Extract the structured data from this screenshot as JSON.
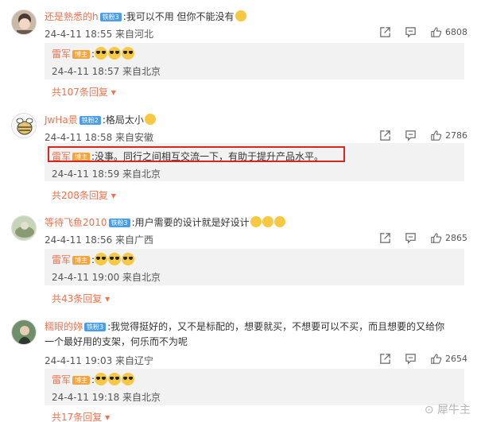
{
  "icons": {
    "share": "share-icon",
    "comment": "comment-icon",
    "like": "thumbs-up-icon",
    "host_badge": "host-badge",
    "level_badge": "level-badge"
  },
  "colors": {
    "username": "#eb7350",
    "reply_bg": "#f2f2f2",
    "highlight": "#d7261c",
    "badge": "#4a9ee9"
  },
  "comments": [
    {
      "user": "还是熟悉的h",
      "badge": "铁粉3",
      "text": ":我可以不用  但你不能没有",
      "time": "24-4-11 18:55 来自河北",
      "likes": "6808",
      "reply": {
        "user": "雷军",
        "host_badge": "博主",
        "time": "24-4-11 18:57 来自北京"
      },
      "more": "共107条回复"
    },
    {
      "user": "JwHa景",
      "badge": "铁粉2",
      "text": ":格局太小",
      "time": "24-4-11 18:58 来自安徽",
      "likes": "2786",
      "reply": {
        "user": "雷军",
        "host_badge": "博主",
        "text": ":没事。同行之间相互交流一下，有助于提升产品水平。",
        "time": "24-4-11 18:59 来自北京"
      },
      "more": "共208条回复"
    },
    {
      "user": "等待飞鱼2010",
      "badge": "铁粉3",
      "text": ":用户需要的设计就是好设计",
      "time": "24-4-11 18:56 来自广西",
      "likes": "2865",
      "reply": {
        "user": "雷军",
        "host_badge": "博主",
        "time": "24-4-11 19:00 来自北京"
      },
      "more": "共43条回复"
    },
    {
      "user": "糯眼的妳",
      "badge": "铁粉3",
      "text": ":我觉得挺好的，又不是标配的，想要就买，不想要可以不买，而且想要的又给你",
      "text2": "一个最好用的支架，何乐而不为呢",
      "time": "24-4-11 19:03 来自辽宁",
      "likes": "2654",
      "reply": {
        "user": "雷军",
        "host_badge": "博主",
        "time": "24-4-11 19:18 来自北京"
      },
      "more": "共17条回复"
    }
  ],
  "watermark": "犀牛主"
}
